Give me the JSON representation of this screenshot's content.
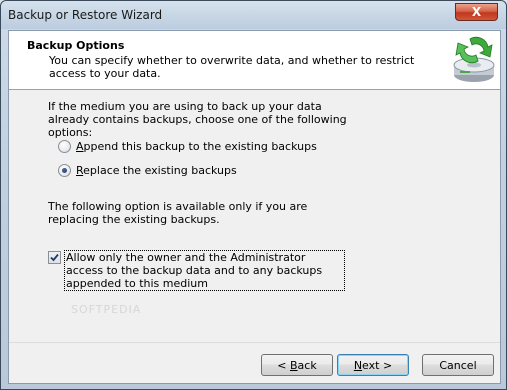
{
  "window": {
    "title": "Backup or Restore Wizard",
    "close_label": "X"
  },
  "header": {
    "title": "Backup Options",
    "description": "You can specify whether to overwrite data, and whether to restrict access to your data."
  },
  "intro": "If the medium you are using to back up your data already contains backups, choose one of the following options:",
  "options": [
    {
      "label_before": "",
      "mnemonic": "A",
      "label_after": "ppend this backup to the existing backups",
      "checked": false
    },
    {
      "label_before": "",
      "mnemonic": "R",
      "label_after": "eplace the existing backups",
      "checked": true
    }
  ],
  "note": "The following option is available only if you are replacing the existing backups.",
  "restrict_access": {
    "label": "Allow only the owner and the Administrator access to the backup data and to any backups appended to this medium",
    "checked": true
  },
  "watermark": "SOFTPEDIA",
  "buttons": {
    "back": {
      "prefix": "< ",
      "mnemonic": "B",
      "rest": "ack"
    },
    "next": {
      "prefix": "",
      "mnemonic": "N",
      "rest": "ext >"
    },
    "cancel": {
      "label": "Cancel"
    }
  },
  "colors": {
    "accent": "#3c7fb1",
    "close": "#c0381d"
  }
}
